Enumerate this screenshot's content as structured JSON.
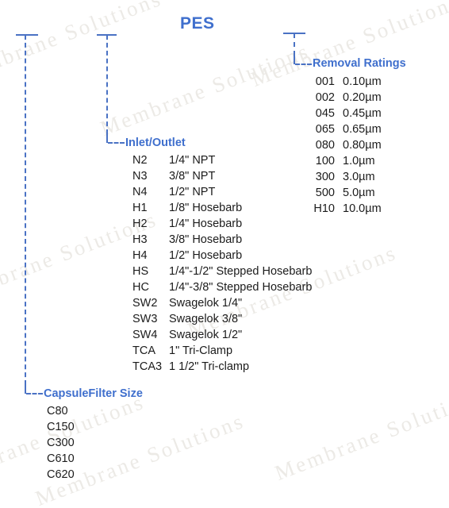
{
  "title": "PES",
  "watermark": {
    "text": "Membrane Solutions",
    "color": "#eceae6"
  },
  "colors": {
    "accent": "#3f6fcd",
    "line": "#4a72c4",
    "text": "#1b1b1b"
  },
  "branches": {
    "removal_ratings": {
      "label": "Removal Ratings",
      "items": [
        {
          "code": "001",
          "value": "0.10µm"
        },
        {
          "code": "002",
          "value": "0.20µm"
        },
        {
          "code": "045",
          "value": "0.45µm"
        },
        {
          "code": "065",
          "value": "0.65µm"
        },
        {
          "code": "080",
          "value": "0.80µm"
        },
        {
          "code": "100",
          "value": "1.0µm"
        },
        {
          "code": "300",
          "value": "3.0µm"
        },
        {
          "code": "500",
          "value": "5.0µm"
        },
        {
          "code": "H10",
          "value": "10.0µm"
        }
      ]
    },
    "inlet_outlet": {
      "label": "Inlet/Outlet",
      "items": [
        {
          "code": "N2",
          "value": "1/4\" NPT"
        },
        {
          "code": "N3",
          "value": "3/8\" NPT"
        },
        {
          "code": "N4",
          "value": "1/2\" NPT"
        },
        {
          "code": "H1",
          "value": "1/8\" Hosebarb"
        },
        {
          "code": "H2",
          "value": "1/4\" Hosebarb"
        },
        {
          "code": "H3",
          "value": "3/8\" Hosebarb"
        },
        {
          "code": "H4",
          "value": "1/2\" Hosebarb"
        },
        {
          "code": "HS",
          "value": "1/4\"-1/2\" Stepped Hosebarb"
        },
        {
          "code": "HC",
          "value": "1/4\"-3/8\" Stepped Hosebarb"
        },
        {
          "code": "SW2",
          "value": "Swagelok 1/4\""
        },
        {
          "code": "SW3",
          "value": "Swagelok 3/8\""
        },
        {
          "code": "SW4",
          "value": "Swagelok 1/2\""
        },
        {
          "code": "TCA",
          "value": "1\" Tri-Clamp"
        },
        {
          "code": "TCA3",
          "value": "1 1/2\" Tri-clamp"
        }
      ]
    },
    "capsule_filter_size": {
      "label": "CapsuleFilter Size",
      "items": [
        {
          "code": "C80"
        },
        {
          "code": "C150"
        },
        {
          "code": "C300"
        },
        {
          "code": "C610"
        },
        {
          "code": "C620"
        }
      ]
    }
  }
}
